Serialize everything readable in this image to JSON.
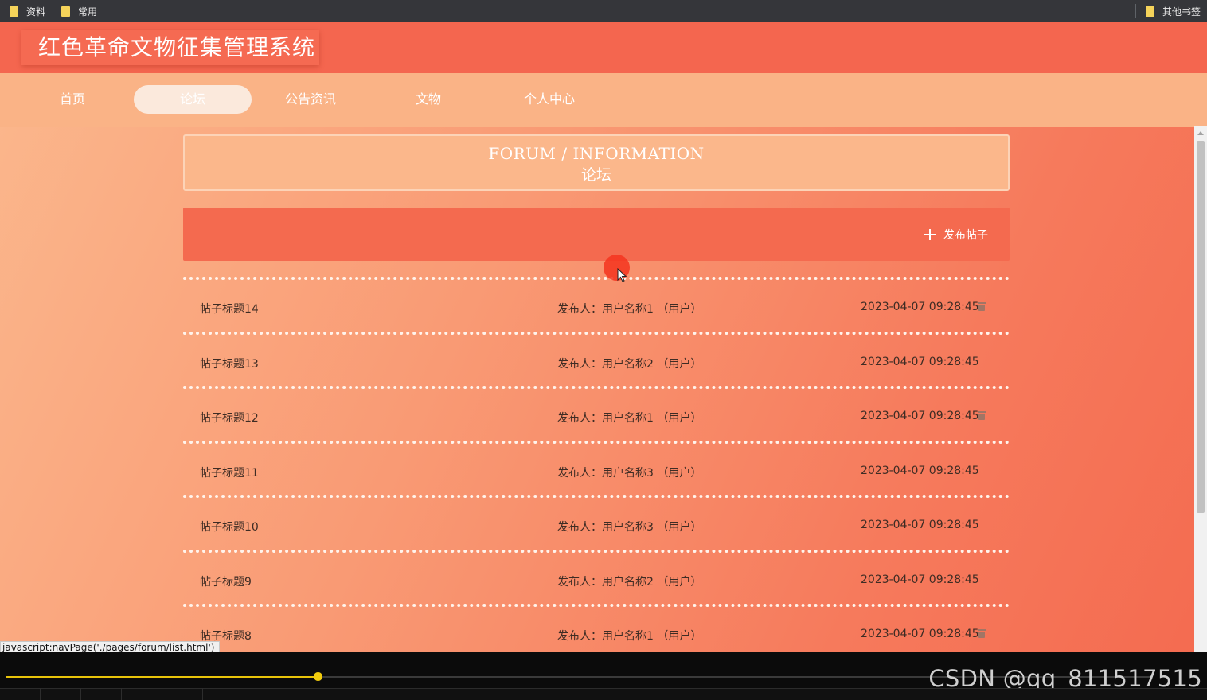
{
  "browser": {
    "bookmarks": [
      {
        "label": "资料"
      },
      {
        "label": "常用"
      }
    ],
    "other_bookmarks": "其他书签",
    "status_link": "javascript:navPage('./pages/forum/list.html')"
  },
  "site": {
    "title": "红色革命文物征集管理系统"
  },
  "nav": {
    "items": [
      {
        "label": "首页",
        "active": false
      },
      {
        "label": "论坛",
        "active": true
      },
      {
        "label": "公告资讯",
        "active": false
      },
      {
        "label": "文物",
        "active": false
      },
      {
        "label": "个人中心",
        "active": false
      }
    ]
  },
  "banner": {
    "title_en": "FORUM / INFORMATION",
    "title_cn": "论坛"
  },
  "actions": {
    "publish_label": "发布帖子"
  },
  "forum": {
    "posts": [
      {
        "title": "帖子标题14",
        "author": "发布人：用户名称1 （用户）",
        "time": "2023-04-07 09:28:45",
        "deletable": true
      },
      {
        "title": "帖子标题13",
        "author": "发布人：用户名称2 （用户）",
        "time": "2023-04-07 09:28:45",
        "deletable": false
      },
      {
        "title": "帖子标题12",
        "author": "发布人：用户名称1 （用户）",
        "time": "2023-04-07 09:28:45",
        "deletable": true
      },
      {
        "title": "帖子标题11",
        "author": "发布人：用户名称3 （用户）",
        "time": "2023-04-07 09:28:45",
        "deletable": false
      },
      {
        "title": "帖子标题10",
        "author": "发布人：用户名称3 （用户）",
        "time": "2023-04-07 09:28:45",
        "deletable": false
      },
      {
        "title": "帖子标题9",
        "author": "发布人：用户名称2 （用户）",
        "time": "2023-04-07 09:28:45",
        "deletable": false
      },
      {
        "title": "帖子标题8",
        "author": "发布人：用户名称1 （用户）",
        "time": "2023-04-07 09:28:45",
        "deletable": true
      }
    ]
  },
  "player": {
    "progress": 0.272,
    "watermark": "CSDN @qq_811517515"
  },
  "colors": {
    "header": "#f4664f",
    "nav": "#fab386",
    "accent": "#f46a4f",
    "progress": "#e8c30a"
  }
}
